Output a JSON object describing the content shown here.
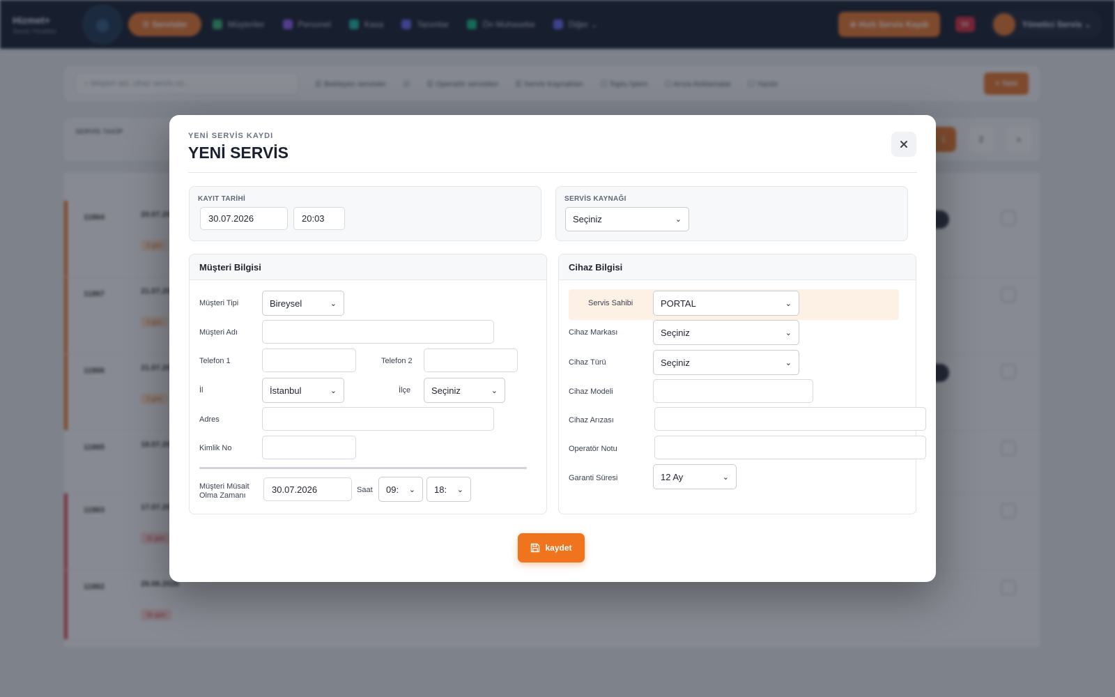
{
  "modal": {
    "eyebrow": "YENİ SERVİS KAYDI",
    "title": "YENİ SERVİS",
    "close_icon": "close-icon",
    "save_label": "kaydet",
    "save_icon": "floppy-disk-icon"
  },
  "kayit": {
    "label": "KAYIT TARİHİ",
    "date": "30.07.2026",
    "time": "20:03"
  },
  "kaynak": {
    "label": "SERVİS KAYNAĞI",
    "selected": "Seçiniz"
  },
  "musteri": {
    "title": "Müşteri Bilgisi",
    "tipi_label": "Müşteri Tipi",
    "tipi_value": "Bireysel",
    "adi_label": "Müşteri Adı",
    "adi_value": "",
    "tel1_label": "Telefon 1",
    "tel1_value": "",
    "tel2_label": "Telefon 2",
    "tel2_value": "",
    "il_label": "İl",
    "il_value": "İstanbul",
    "ilce_label": "İlçe",
    "ilce_value": "Seçiniz",
    "adres_label": "Adres",
    "adres_value": "",
    "kimlik_label": "Kimlik No",
    "kimlik_value": "",
    "musait_label_1": "Müşteri Müsait",
    "musait_label_2": "Olma Zamanı",
    "musait_date": "30.07.2026",
    "saat_label": "Saat",
    "saat_start": "09:",
    "saat_end": "18:"
  },
  "cihaz": {
    "title": "Cihaz Bilgisi",
    "sahibi_label": "Servis Sahibi",
    "sahibi_value": "PORTAL",
    "marka_label": "Cihaz Markası",
    "marka_value": "Seçiniz",
    "tur_label": "Cihaz Türü",
    "tur_value": "Seçiniz",
    "model_label": "Cihaz Modeli",
    "model_value": "",
    "ariza_label": "Cihaz Arızası",
    "ariza_value": "",
    "not_label": "Operatör Notu",
    "not_value": "",
    "garanti_label": "Garanti Süresi",
    "garanti_value": "12 Ay"
  },
  "colors": {
    "accent": "#f0741d",
    "nav_bg": "#121a2c",
    "owner_highlight": "#fdf1e6"
  }
}
